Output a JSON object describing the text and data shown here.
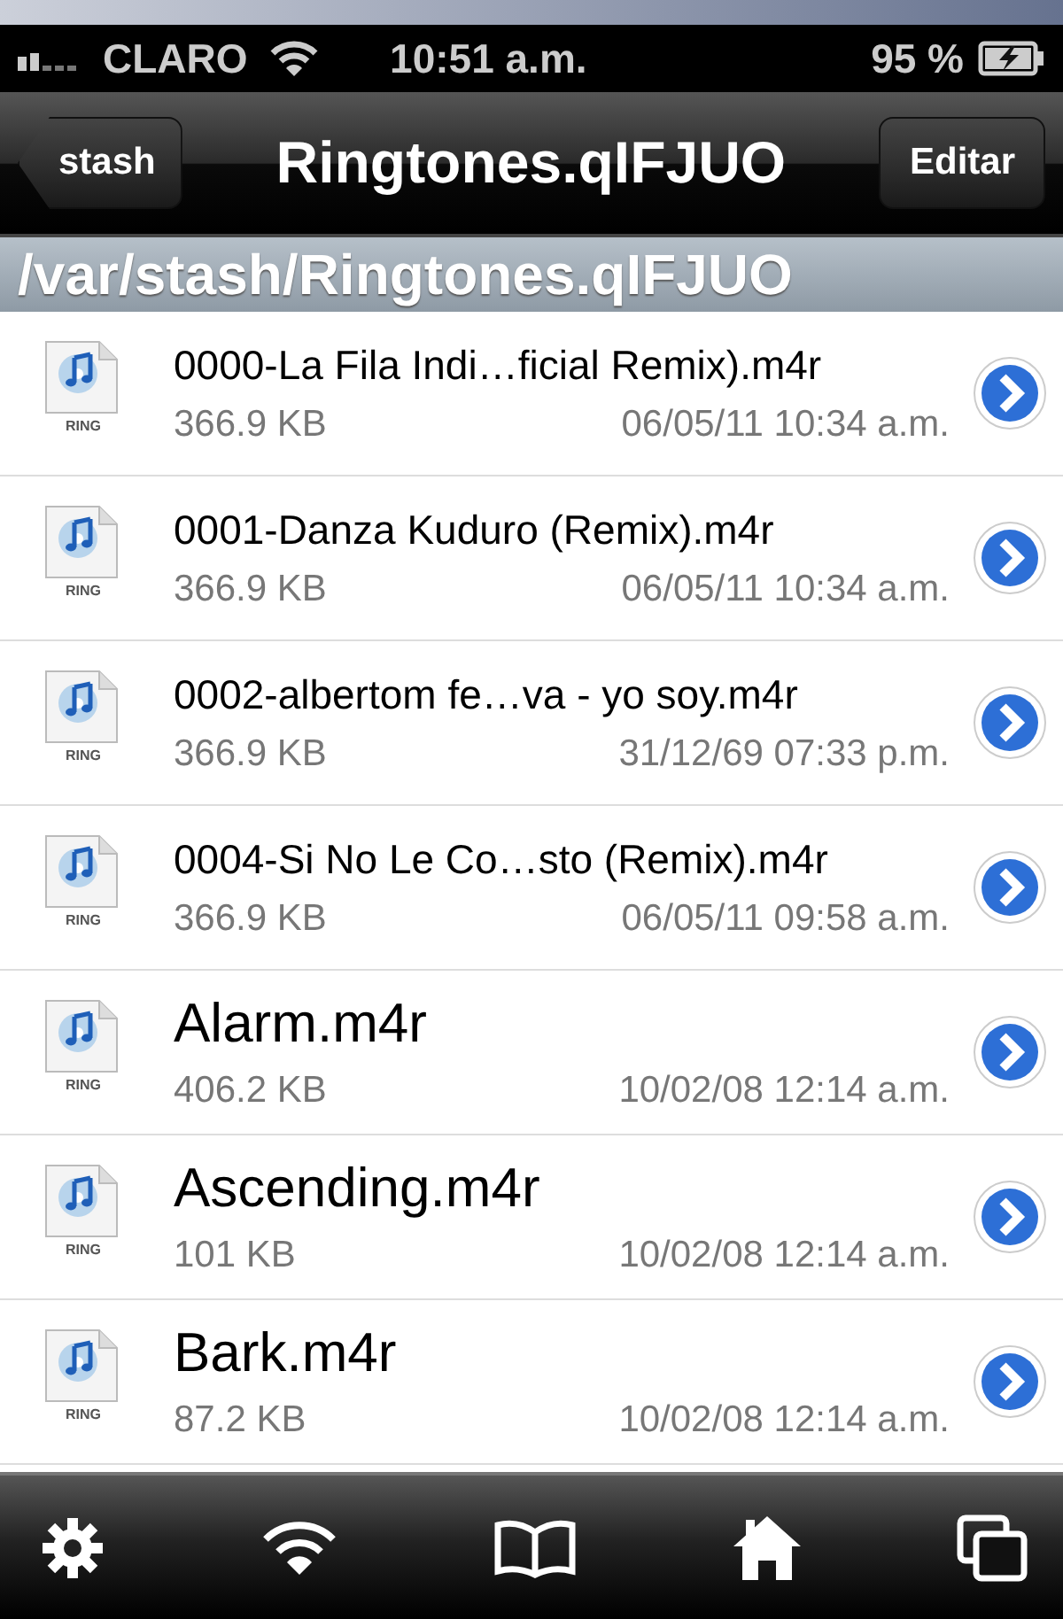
{
  "status_bar": {
    "carrier": "CLARO",
    "time": "10:51 a.m.",
    "battery": "95 %"
  },
  "nav_bar": {
    "back": "stash",
    "title": "Ringtones.qIFJUO",
    "edit": "Editar"
  },
  "path": "/var/stash/Ringtones.qIFJUO",
  "files": [
    {
      "name": "0000-La Fila Indi…ficial Remix).m4r",
      "size": "366.9 KB",
      "date": "06/05/11 10:34 a.m.",
      "icon_label": "RING"
    },
    {
      "name": "0001-Danza Kuduro (Remix).m4r",
      "size": "366.9 KB",
      "date": "06/05/11 10:34 a.m.",
      "icon_label": "RING"
    },
    {
      "name": "0002-albertom fe…va - yo soy.m4r",
      "size": "366.9 KB",
      "date": "31/12/69 07:33 p.m.",
      "icon_label": "RING"
    },
    {
      "name": "0004-Si No Le Co…sto (Remix).m4r",
      "size": "366.9 KB",
      "date": "06/05/11 09:58 a.m.",
      "icon_label": "RING"
    },
    {
      "name": "Alarm.m4r",
      "size": "406.2 KB",
      "date": "10/02/08 12:14 a.m.",
      "icon_label": "RING"
    },
    {
      "name": "Ascending.m4r",
      "size": "101 KB",
      "date": "10/02/08 12:14 a.m.",
      "icon_label": "RING"
    },
    {
      "name": "Bark.m4r",
      "size": "87.2 KB",
      "date": "10/02/08 12:14 a.m.",
      "icon_label": "RING"
    }
  ],
  "tab_bar": [
    {
      "kind": "gear"
    },
    {
      "kind": "wifi"
    },
    {
      "kind": "book"
    },
    {
      "kind": "home"
    },
    {
      "kind": "windows"
    }
  ]
}
